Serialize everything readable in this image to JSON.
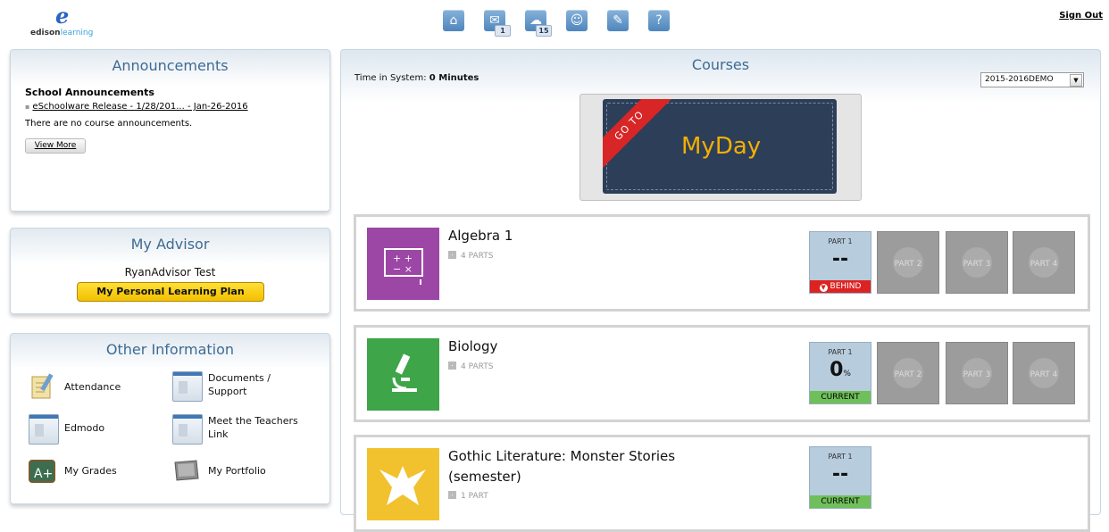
{
  "header": {
    "logo_mark": "e",
    "logo_word_1": "edison",
    "logo_word_2": "learning",
    "nav": [
      {
        "icon": "home-icon",
        "glyph": "⌂",
        "badge": ""
      },
      {
        "icon": "messages-icon",
        "glyph": "✉",
        "badge": "1"
      },
      {
        "icon": "alerts-icon",
        "glyph": "☁",
        "badge": "15"
      },
      {
        "icon": "people-icon",
        "glyph": "☺",
        "badge": ""
      },
      {
        "icon": "edit-icon",
        "glyph": "✎",
        "badge": ""
      },
      {
        "icon": "help-icon",
        "glyph": "?",
        "badge": ""
      }
    ],
    "sign_out": "Sign Out"
  },
  "announcements": {
    "title": "Announcements",
    "subtitle": "School Announcements",
    "link": "eSchoolware Release - 1/28/201... - Jan-26-2016",
    "note": "There are no course announcements.",
    "view_more": "View More"
  },
  "advisor": {
    "title": "My Advisor",
    "name": "RyanAdvisor Test",
    "plan_button": "My Personal Learning Plan"
  },
  "other_info": {
    "title": "Other Information",
    "items": [
      {
        "label": "Attendance",
        "icon": "attendance-icon"
      },
      {
        "label": "Documents / Support",
        "icon": "documents-icon"
      },
      {
        "label": "Edmodo",
        "icon": "edmodo-icon"
      },
      {
        "label": "Meet the Teachers Link",
        "icon": "teachers-icon"
      },
      {
        "label": "My Grades",
        "icon": "grades-icon"
      },
      {
        "label": "My Portfolio",
        "icon": "portfolio-icon"
      }
    ]
  },
  "courses": {
    "title": "Courses",
    "time_label": "Time in System:",
    "time_value": "0 Minutes",
    "year": "2015-2016DEMO",
    "myday": {
      "ribbon": "GO TO",
      "text": "MyDay"
    },
    "list": [
      {
        "name": "Algebra 1",
        "parts": "4 PARTS",
        "color": "#9c46a6",
        "icon": "math-board-icon",
        "part1": {
          "label": "PART 1",
          "value": "--",
          "unit": "",
          "status": "BEHIND"
        },
        "locked": [
          "PART 2",
          "PART 3",
          "PART 4"
        ]
      },
      {
        "name": "Biology",
        "parts": "4 PARTS",
        "color": "#3ea548",
        "icon": "microscope-icon",
        "part1": {
          "label": "PART 1",
          "value": "0",
          "unit": "%",
          "status": "CURRENT"
        },
        "locked": [
          "PART 2",
          "PART 3",
          "PART 4"
        ]
      },
      {
        "name": "Gothic Literature: Monster Stories (semester)",
        "parts": "1 PART",
        "color": "#f2c12e",
        "icon": "phoenix-icon",
        "part1": {
          "label": "PART 1",
          "value": "--",
          "unit": "",
          "status": "CURRENT"
        },
        "locked": []
      }
    ]
  }
}
